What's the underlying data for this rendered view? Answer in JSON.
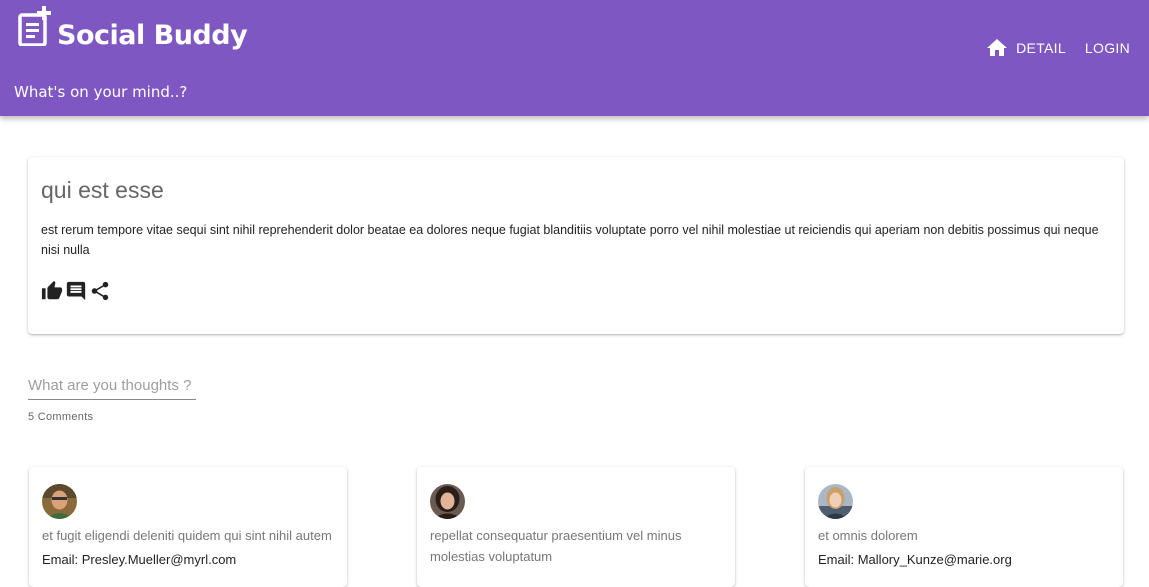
{
  "header": {
    "brand": "Social Buddy",
    "tagline": "What's on your mind..?",
    "nav": {
      "home_icon": "home-icon",
      "detail": "DETAIL",
      "login": "LOGIN"
    },
    "color": "#7e57c2"
  },
  "post": {
    "title": "qui est esse",
    "body": "est rerum tempore vitae sequi sint nihil reprehenderit dolor beatae ea dolores neque fugiat blanditiis voluptate porro vel nihil molestiae ut reiciendis qui aperiam non debitis possimus qui neque nisi nulla",
    "actions": [
      "thumb-up-icon",
      "comment-icon",
      "share-icon"
    ]
  },
  "thoughts": {
    "placeholder": "What are you thoughts ?",
    "value": ""
  },
  "comments_count": "5 Comments",
  "comments": [
    {
      "name": "et fugit eligendi deleniti quidem qui sint nihil autem",
      "email": "Email: Presley.Mueller@myrl.com"
    },
    {
      "name": "repellat consequatur praesentium vel minus molestias voluptatum",
      "email": ""
    },
    {
      "name": "et omnis dolorem",
      "email": "Email: Mallory_Kunze@marie.org"
    }
  ]
}
